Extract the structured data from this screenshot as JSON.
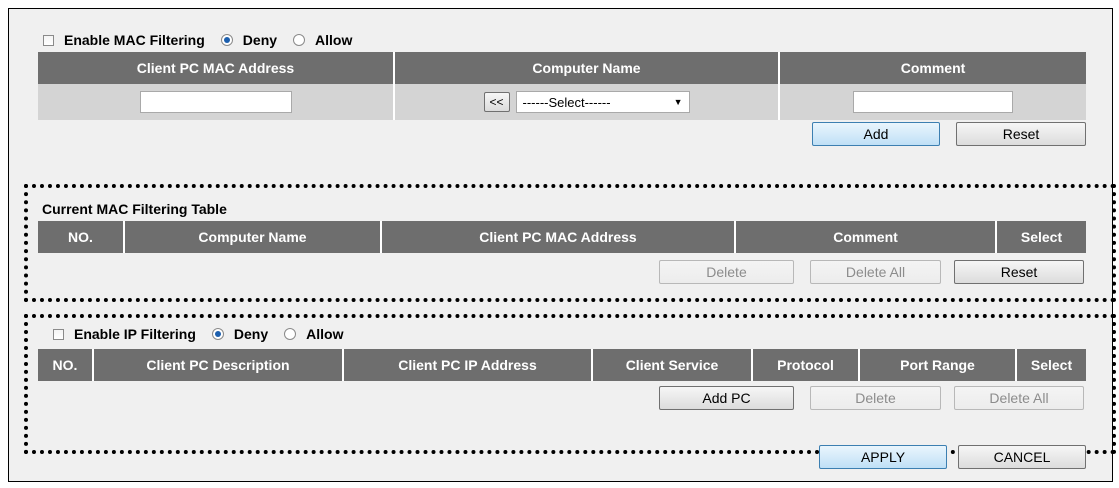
{
  "mac_filter": {
    "enable_label": "Enable MAC Filtering",
    "deny_label": "Deny",
    "allow_label": "Allow",
    "enabled": false,
    "mode": "Deny",
    "columns": [
      "Client PC MAC Address",
      "Computer Name",
      "Comment"
    ],
    "mac_input_value": "",
    "comment_input_value": "",
    "move_button_label": "<<",
    "computer_select_value": "------Select------",
    "add_label": "Add",
    "reset_label": "Reset"
  },
  "mac_table": {
    "title": "Current MAC Filtering Table",
    "columns": [
      "NO.",
      "Computer Name",
      "Client PC MAC Address",
      "Comment",
      "Select"
    ],
    "delete_label": "Delete",
    "delete_all_label": "Delete All",
    "reset_label": "Reset"
  },
  "ip_filter": {
    "enable_label": "Enable IP Filtering",
    "deny_label": "Deny",
    "allow_label": "Allow",
    "enabled": false,
    "mode": "Deny",
    "columns": [
      "NO.",
      "Client PC Description",
      "Client PC IP Address",
      "Client Service",
      "Protocol",
      "Port Range",
      "Select"
    ],
    "add_pc_label": "Add PC",
    "delete_label": "Delete",
    "delete_all_label": "Delete All"
  },
  "footer": {
    "apply_label": "APPLY",
    "cancel_label": "CANCEL"
  },
  "colors": {
    "header_bg": "#6e6e6e",
    "panel_bg": "#f0f0f0",
    "input_row_bg": "#d4d4d4"
  }
}
